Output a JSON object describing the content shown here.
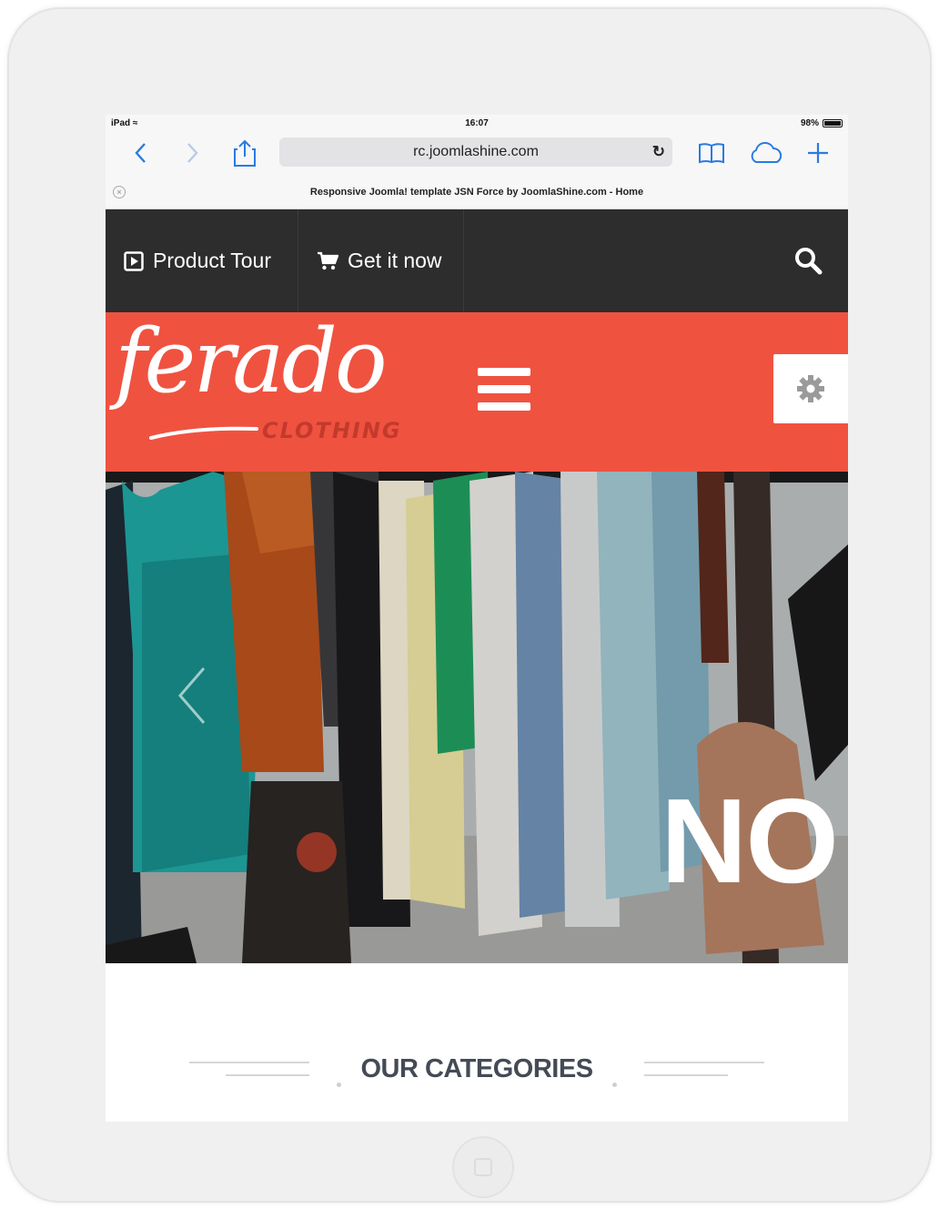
{
  "status_bar": {
    "device": "iPad",
    "time": "16:07",
    "battery": "98%"
  },
  "browser": {
    "url": "rc.joomlashine.com",
    "tab_title": "Responsive Joomla! template JSN Force by JoomlaShine.com - Home"
  },
  "topnav": {
    "items": [
      {
        "label": "Product Tour",
        "icon": "play-square-icon"
      },
      {
        "label": "Get it now",
        "icon": "cart-icon"
      }
    ],
    "search_icon": "search-icon"
  },
  "brand": {
    "logo_main": "ferado",
    "logo_sub": "CLOTHING",
    "color": "#f05240"
  },
  "hero": {
    "overlay_text": "NO"
  },
  "section": {
    "title": "OUR CATEGORIES"
  },
  "colors": {
    "nav_bg": "#2d2d2d",
    "accent": "#f05240",
    "safari_blue": "#2a7ae2"
  }
}
